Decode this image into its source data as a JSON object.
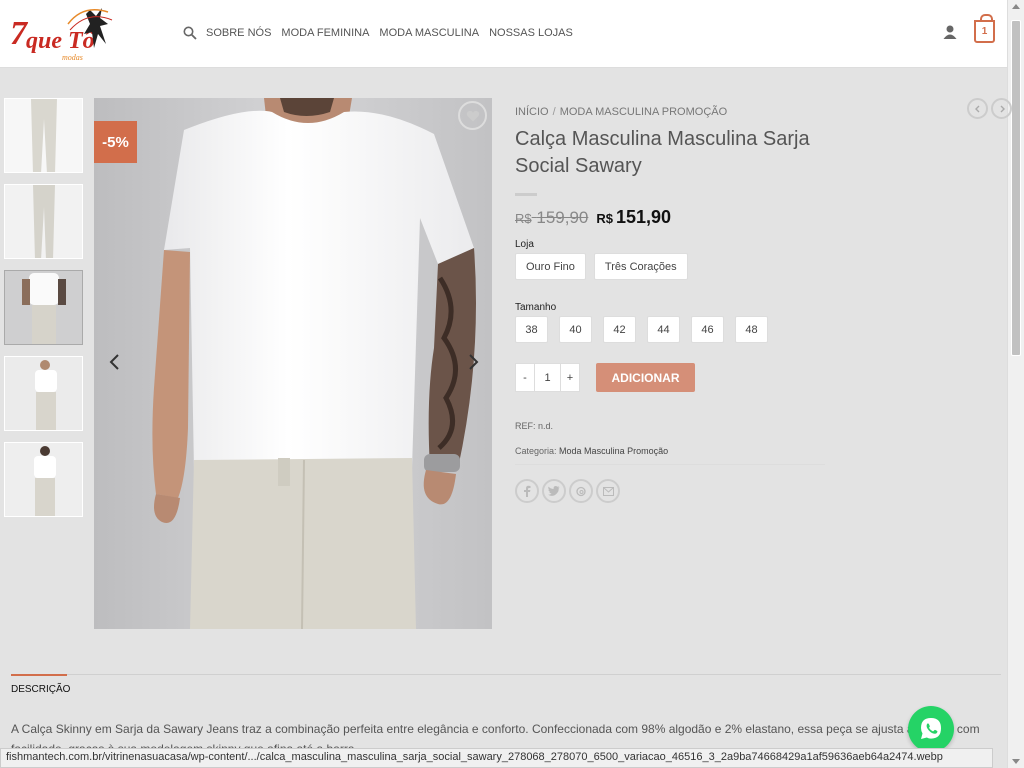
{
  "header": {
    "logo_text": "7que Tô",
    "logo_sub": "modas",
    "nav": [
      "SOBRE NÓS",
      "MODA FEMININA",
      "MODA MASCULINA",
      "NOSSAS LOJAS"
    ],
    "cart_count": "1"
  },
  "product": {
    "badge": "-5%",
    "breadcrumb": [
      "INÍCIO",
      "MODA MASCULINA PROMOÇÃO"
    ],
    "title": "Calça Masculina Masculina Sarja Social Sawary",
    "old_price_cur": "R$",
    "old_price": "159,90",
    "new_price_cur": "R$",
    "new_price": "151,90",
    "store_label": "Loja",
    "stores": [
      "Ouro Fino",
      "Três Corações"
    ],
    "size_label": "Tamanho",
    "sizes": [
      "38",
      "40",
      "42",
      "44",
      "46",
      "48"
    ],
    "qty_minus": "-",
    "qty": "1",
    "qty_plus": "+",
    "add_label": "ADICIONAR",
    "ref": "REF: n.d.",
    "category_label": "Categoria:",
    "category": "Moda Masculina Promoção"
  },
  "tabs": {
    "description_label": "DESCRIÇÃO",
    "description_text": "A Calça Skinny em Sarja da Sawary Jeans traz a combinação perfeita entre elegância e conforto. Confeccionada com 98% algodão e 2% elastano, essa peça se ajusta ao corpo com facilidade, graças à sua modelagem skinny que afina até a barra."
  },
  "status_url": "fishmantech.com.br/vitrinenasuacasa/wp-content/.../calca_masculina_masculina_sarja_social_sawary_278068_278070_6500_variacao_46516_3_2a9ba74668429a1af59636aeb64a2474.webp",
  "colors": {
    "accent": "#d26e4b",
    "button": "#d58f78",
    "whatsapp": "#25d366"
  }
}
